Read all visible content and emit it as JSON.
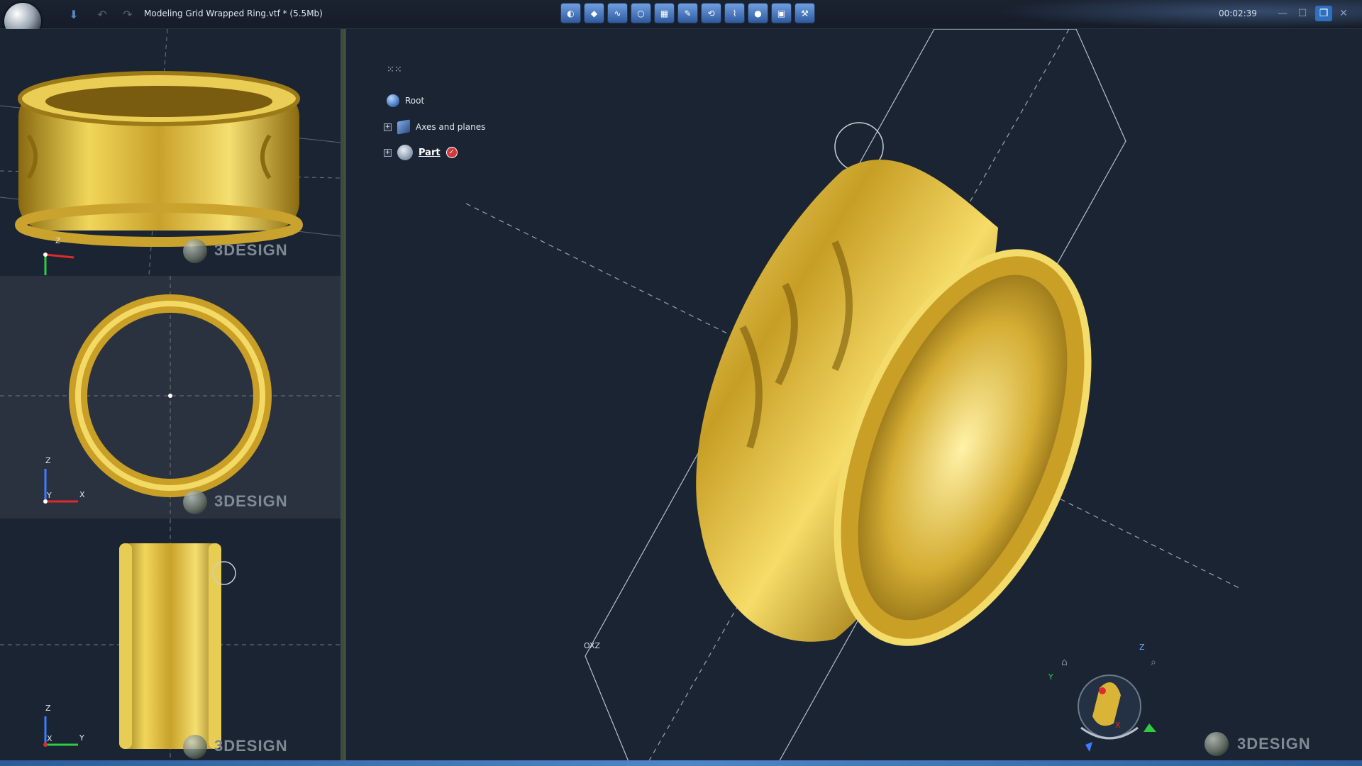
{
  "titlebar": {
    "document_title": "Modeling Grid Wrapped Ring.vtf * (5.5Mb)",
    "clock": "00:02:39",
    "window_controls": [
      "minimize-icon",
      "maximize-icon",
      "restore-icon",
      "close-icon"
    ],
    "quick_buttons": [
      "save-icon",
      "undo-icon",
      "redo-icon"
    ],
    "toolbar_icons": [
      "primitives-icon",
      "gem-icon",
      "curves-icon",
      "ring-wizard-icon",
      "grid-icon",
      "surface-icon",
      "rotate-icon",
      "deform-icon",
      "color-icon",
      "render-icon",
      "bench-icon"
    ]
  },
  "views": {
    "top": {
      "axis_a": "Z",
      "axis_b": ""
    },
    "front": {
      "axis_a": "Z",
      "axis_b": "X",
      "axis_c": "Y"
    },
    "side": {
      "axis_a": "Z",
      "axis_b": "Y",
      "axis_c": "X"
    }
  },
  "watermark": "3DESIGN",
  "tree": {
    "items": [
      {
        "label": "Root",
        "icon": "globe-icon"
      },
      {
        "label": "Axes and planes",
        "icon": "planes-icon"
      },
      {
        "label": "Part",
        "icon": "part-icon"
      }
    ]
  },
  "main": {
    "plane_label": "OXZ",
    "navigator": {
      "z": "Z",
      "y": "Y",
      "x": "X"
    }
  },
  "colors": {
    "background": "#1b2432",
    "gold": "#d9b437",
    "accent": "#2f6fbf"
  }
}
